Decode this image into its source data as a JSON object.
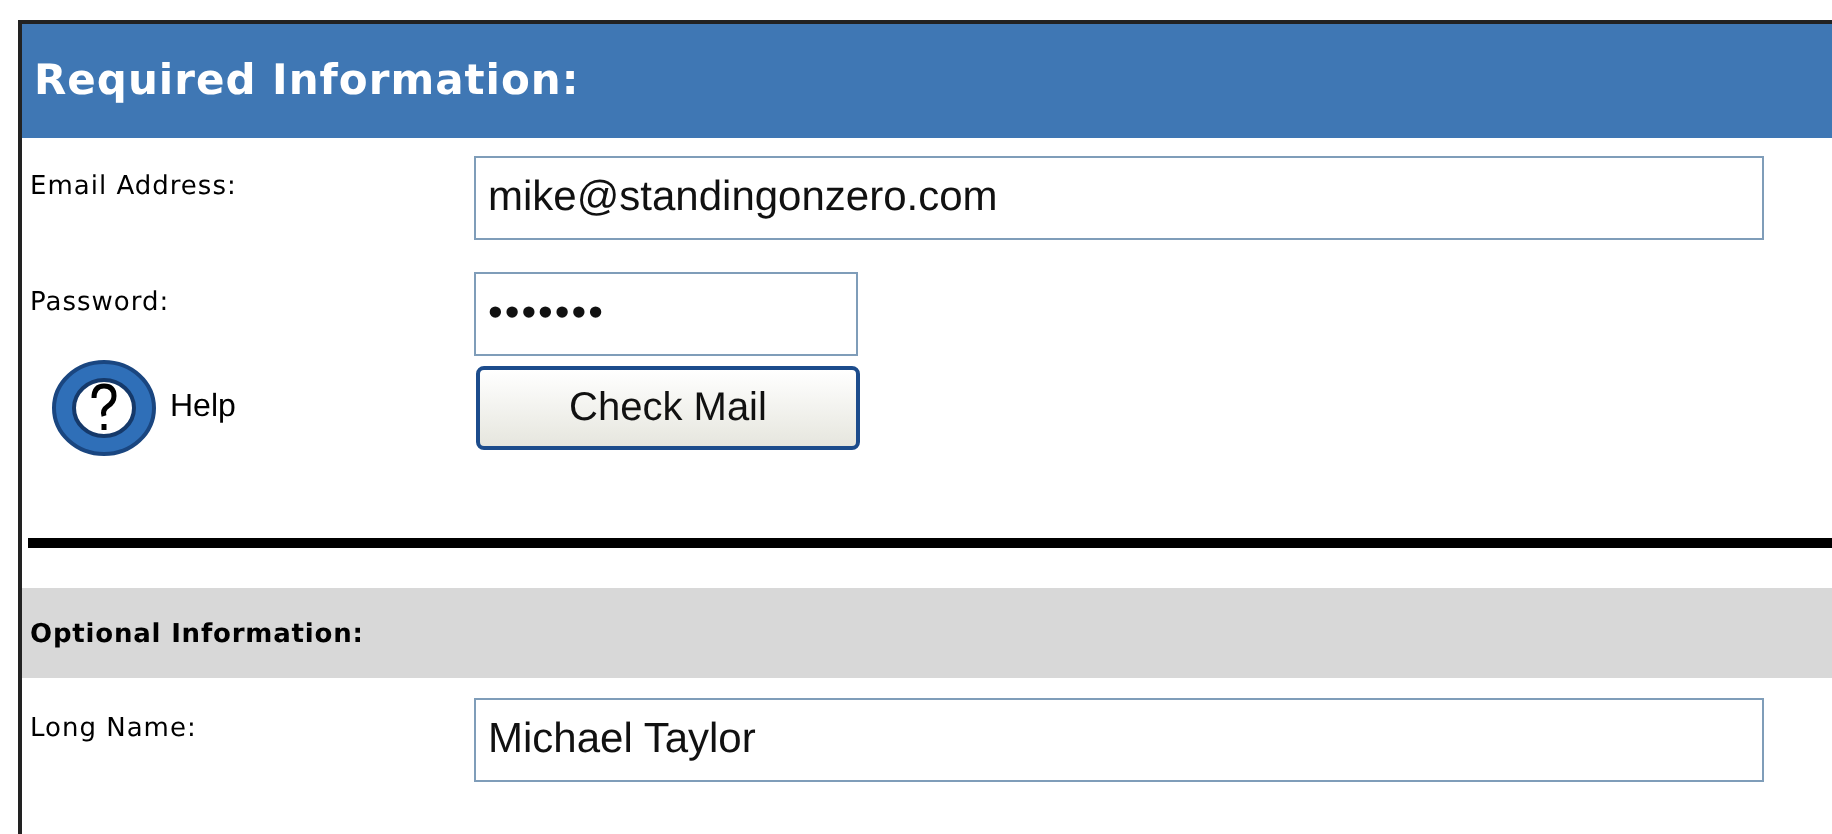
{
  "required": {
    "title": "Required Information:",
    "fields": [
      {
        "label": "Email Address:",
        "value": "mike@standingonzero.com",
        "kind": "wide"
      },
      {
        "label": "Password:",
        "value": "•••••••",
        "kind": "short"
      }
    ],
    "help": "Help",
    "button": "Check Mail"
  },
  "optional": {
    "title": "Optional Information:",
    "fields": [
      {
        "label": "Long Name:",
        "value": "Michael Taylor",
        "kind": "wide"
      }
    ]
  }
}
